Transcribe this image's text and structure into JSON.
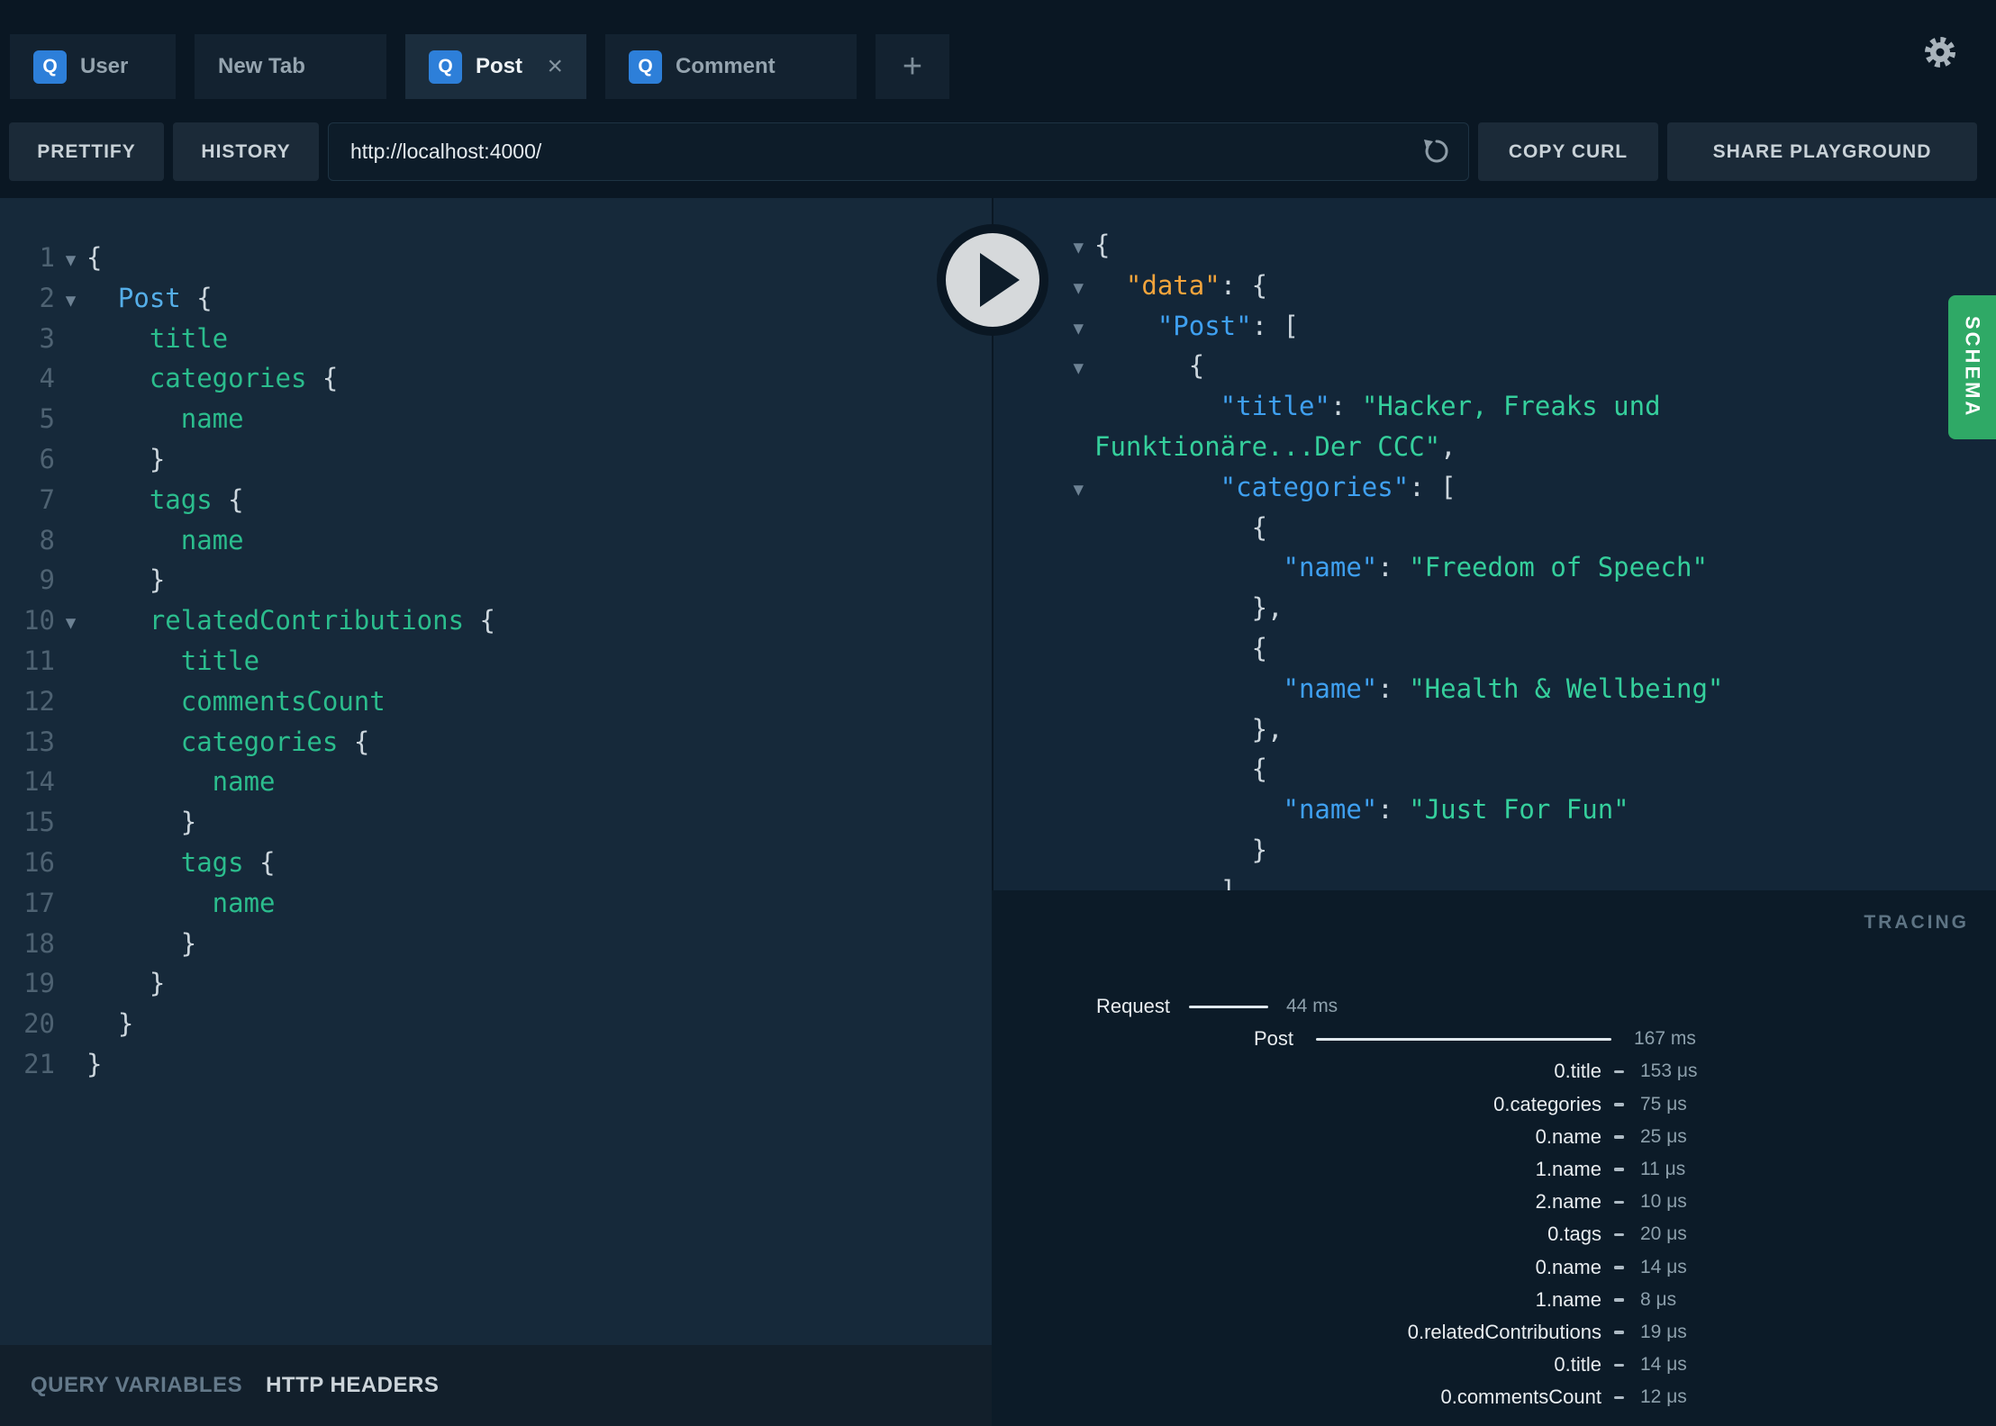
{
  "colors": {
    "badge_blue": "#2d7fd9",
    "schema_green": "#2fa966",
    "field_green": "#2bbd8d",
    "root_field_blue": "#55aee8",
    "json_key_blue": "#3fa0f0",
    "json_key_orange": "#f2a43c",
    "string_green": "#35cf9c"
  },
  "icons": {
    "badge": "Q",
    "close": "×",
    "plus": "+",
    "fold": "▾"
  },
  "tabs": [
    {
      "label": "User"
    },
    {
      "label": "New Tab"
    },
    {
      "label": "Post"
    },
    {
      "label": "Comment"
    }
  ],
  "toolbar": {
    "prettify": "PRETTIFY",
    "history": "HISTORY",
    "url": "http://localhost:4000/",
    "copy_curl": "COPY CURL",
    "share_playground": "SHARE PLAYGROUND"
  },
  "query_editor": {
    "lines": [
      {
        "n": "1",
        "fold": true,
        "toks": [
          [
            "p",
            "{"
          ]
        ]
      },
      {
        "n": "2",
        "fold": true,
        "toks": [
          [
            "b",
            "  Post"
          ],
          [
            "p",
            " {"
          ]
        ]
      },
      {
        "n": "3",
        "toks": [
          [
            "f",
            "    title"
          ]
        ]
      },
      {
        "n": "4",
        "toks": [
          [
            "f",
            "    categories"
          ],
          [
            "p",
            " {"
          ]
        ]
      },
      {
        "n": "5",
        "toks": [
          [
            "f",
            "      name"
          ]
        ]
      },
      {
        "n": "6",
        "toks": [
          [
            "p",
            "    }"
          ]
        ]
      },
      {
        "n": "7",
        "toks": [
          [
            "f",
            "    tags"
          ],
          [
            "p",
            " {"
          ]
        ]
      },
      {
        "n": "8",
        "toks": [
          [
            "f",
            "      name"
          ]
        ]
      },
      {
        "n": "9",
        "toks": [
          [
            "p",
            "    }"
          ]
        ]
      },
      {
        "n": "10",
        "fold": true,
        "toks": [
          [
            "f",
            "    relatedContributions"
          ],
          [
            "p",
            " {"
          ]
        ]
      },
      {
        "n": "11",
        "toks": [
          [
            "f",
            "      title"
          ]
        ]
      },
      {
        "n": "12",
        "toks": [
          [
            "f",
            "      commentsCount"
          ]
        ]
      },
      {
        "n": "13",
        "toks": [
          [
            "f",
            "      categories"
          ],
          [
            "p",
            " {"
          ]
        ]
      },
      {
        "n": "14",
        "toks": [
          [
            "f",
            "        name"
          ]
        ]
      },
      {
        "n": "15",
        "toks": [
          [
            "p",
            "      }"
          ]
        ]
      },
      {
        "n": "16",
        "toks": [
          [
            "f",
            "      tags"
          ],
          [
            "p",
            " {"
          ]
        ]
      },
      {
        "n": "17",
        "toks": [
          [
            "f",
            "        name"
          ]
        ]
      },
      {
        "n": "18",
        "toks": [
          [
            "p",
            "      }"
          ]
        ]
      },
      {
        "n": "19",
        "toks": [
          [
            "p",
            "    }"
          ]
        ]
      },
      {
        "n": "20",
        "toks": [
          [
            "p",
            "  }"
          ]
        ]
      },
      {
        "n": "21",
        "toks": [
          [
            "p",
            "}"
          ]
        ]
      }
    ]
  },
  "response": {
    "lines": [
      {
        "fold": true,
        "toks": [
          [
            "p",
            "{"
          ]
        ]
      },
      {
        "fold": true,
        "toks": [
          [
            "d",
            "  \"data\""
          ],
          [
            "p",
            ": {"
          ]
        ]
      },
      {
        "fold": true,
        "toks": [
          [
            "k",
            "    \"Post\""
          ],
          [
            "p",
            ": ["
          ]
        ]
      },
      {
        "fold": true,
        "toks": [
          [
            "p",
            "      {"
          ]
        ]
      },
      {
        "toks": [
          [
            "k",
            "        \"title\""
          ],
          [
            "p",
            ": "
          ],
          [
            "s",
            "\"Hacker, Freaks und"
          ]
        ]
      },
      {
        "toks": [
          [
            "s",
            "Funktionäre...Der CCC\""
          ],
          [
            "p",
            ","
          ]
        ]
      },
      {
        "fold": true,
        "toks": [
          [
            "k",
            "        \"categories\""
          ],
          [
            "p",
            ": ["
          ]
        ]
      },
      {
        "toks": [
          [
            "p",
            "          {"
          ]
        ]
      },
      {
        "toks": [
          [
            "k",
            "            \"name\""
          ],
          [
            "p",
            ": "
          ],
          [
            "s",
            "\"Freedom of Speech\""
          ]
        ]
      },
      {
        "toks": [
          [
            "p",
            "          },"
          ]
        ]
      },
      {
        "toks": [
          [
            "p",
            "          {"
          ]
        ]
      },
      {
        "toks": [
          [
            "k",
            "            \"name\""
          ],
          [
            "p",
            ": "
          ],
          [
            "s",
            "\"Health & Wellbeing\""
          ]
        ]
      },
      {
        "toks": [
          [
            "p",
            "          },"
          ]
        ]
      },
      {
        "toks": [
          [
            "p",
            "          {"
          ]
        ]
      },
      {
        "toks": [
          [
            "k",
            "            \"name\""
          ],
          [
            "p",
            ": "
          ],
          [
            "s",
            "\"Just For Fun\""
          ]
        ]
      },
      {
        "toks": [
          [
            "p",
            "          }"
          ]
        ]
      },
      {
        "toks": [
          [
            "p",
            "        ]"
          ]
        ]
      }
    ]
  },
  "tracing": {
    "title": "TRACING",
    "rows": [
      {
        "kind": "request",
        "label": "Request",
        "time": "44 ms"
      },
      {
        "kind": "root",
        "label": "Post",
        "time": "167 ms"
      },
      {
        "kind": "leaf",
        "label": "0.title",
        "time": "153 μs"
      },
      {
        "kind": "leaf",
        "label": "0.categories",
        "time": "75 μs"
      },
      {
        "kind": "leaf",
        "label": "0.name",
        "time": "25 μs"
      },
      {
        "kind": "leaf",
        "label": "1.name",
        "time": "11 μs"
      },
      {
        "kind": "leaf",
        "label": "2.name",
        "time": "10 μs"
      },
      {
        "kind": "leaf",
        "label": "0.tags",
        "time": "20 μs"
      },
      {
        "kind": "leaf",
        "label": "0.name",
        "time": "14 μs"
      },
      {
        "kind": "leaf",
        "label": "1.name",
        "time": "8 μs"
      },
      {
        "kind": "leaf",
        "label": "0.relatedContributions",
        "time": "19 μs"
      },
      {
        "kind": "leaf",
        "label": "0.title",
        "time": "14 μs"
      },
      {
        "kind": "leaf",
        "label": "0.commentsCount",
        "time": "12 μs"
      }
    ]
  },
  "bottom_bar": {
    "query_variables": "QUERY VARIABLES",
    "http_headers": "HTTP HEADERS"
  },
  "schema_tab": {
    "label": "SCHEMA"
  }
}
